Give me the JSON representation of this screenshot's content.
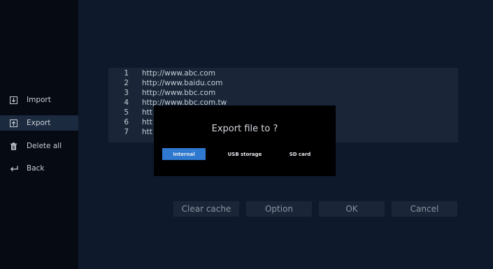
{
  "sidebar": {
    "items": [
      {
        "label": "Import",
        "icon": "import-icon"
      },
      {
        "label": "Export",
        "icon": "export-icon"
      },
      {
        "label": "Delete all",
        "icon": "trash-icon"
      },
      {
        "label": "Back",
        "icon": "back-icon"
      }
    ],
    "active_index": 1
  },
  "url_list": [
    {
      "num": "1",
      "url": "http://www.abc.com"
    },
    {
      "num": "2",
      "url": "http://www.baidu.com"
    },
    {
      "num": "3",
      "url": "http://www.bbc.com"
    },
    {
      "num": "4",
      "url": "http://www.bbc.com.tw"
    },
    {
      "num": "5",
      "url": "htt"
    },
    {
      "num": "6",
      "url": "htt"
    },
    {
      "num": "7",
      "url": "htt"
    }
  ],
  "dialog": {
    "title": "Export file to ?",
    "options": [
      "Internal",
      "USB storage",
      "SD card"
    ],
    "selected_index": 0
  },
  "buttons": {
    "clear_cache": "Clear cache",
    "option": "Option",
    "ok": "OK",
    "cancel": "Cancel"
  },
  "colors": {
    "background": "#0e1a2b",
    "sidebar": "#050a13",
    "accent": "#2f7ad0"
  }
}
